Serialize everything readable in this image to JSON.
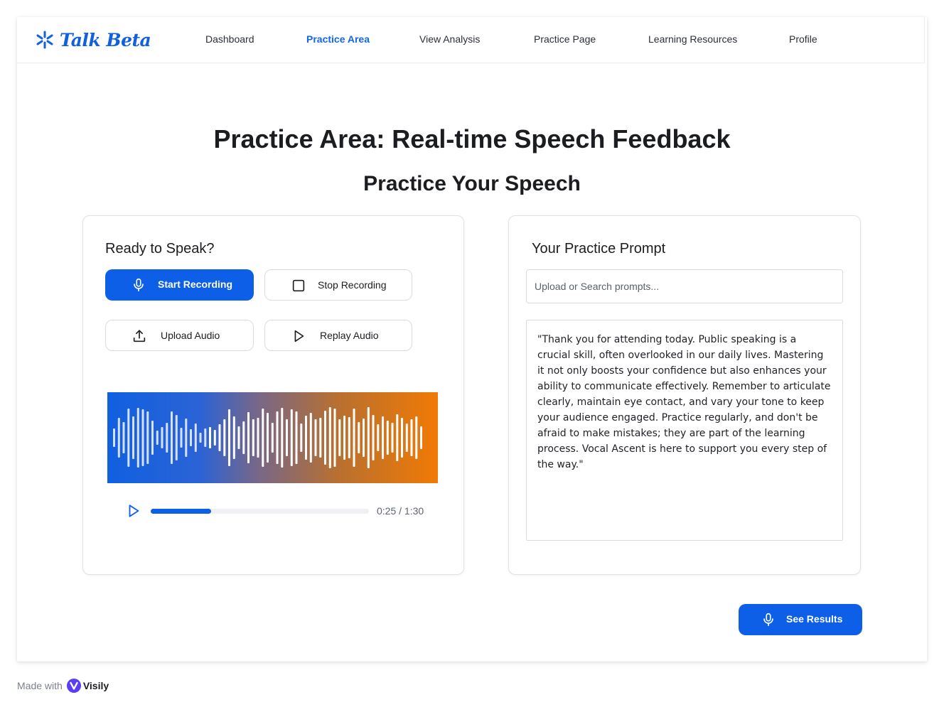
{
  "brand": {
    "name": "Talk Beta",
    "color": "#1060e0"
  },
  "nav": {
    "items": [
      {
        "label": "Dashboard",
        "active": false
      },
      {
        "label": "Practice Area",
        "active": true
      },
      {
        "label": "View Analysis",
        "active": false
      },
      {
        "label": "Practice Page",
        "active": false
      },
      {
        "label": "Learning Resources",
        "active": false
      },
      {
        "label": "Profile",
        "active": false
      }
    ]
  },
  "page": {
    "title": "Practice Area: Real-time Speech Feedback",
    "subtitle": "Practice Your Speech"
  },
  "recorder": {
    "heading": "Ready to Speak?",
    "start_label": "Start Recording",
    "stop_label": "Stop Recording",
    "upload_label": "Upload Audio",
    "replay_label": "Replay Audio",
    "player": {
      "current": "0:25",
      "separator": "/",
      "total": "1:30",
      "progress_fraction": 0.278
    }
  },
  "prompt": {
    "heading": "Your Practice Prompt",
    "search_placeholder": "Upload or Search prompts...",
    "text": "\"Thank you for attending today. Public speaking is a crucial skill, often overlooked in our daily lives. Mastering it not only boosts your confidence but also enhances your ability to communicate effectively. Remember to articulate clearly, maintain eye contact, and vary your tone to keep your audience engaged. Practice regularly, and don't be afraid to make mistakes; they are part of the learning process. Vocal Ascent is here to support you every step of the way.\""
  },
  "actions": {
    "see_results_label": "See Results"
  },
  "footer": {
    "made_with": "Made with",
    "visily": "Visily"
  },
  "colors": {
    "primary": "#0d5fe8",
    "wave_start": "#1060e0",
    "wave_end": "#f07a05"
  },
  "icons": [
    "sparkle-logo-icon",
    "microphone-icon",
    "stop-square-icon",
    "upload-icon",
    "play-icon",
    "visily-logo-icon"
  ]
}
